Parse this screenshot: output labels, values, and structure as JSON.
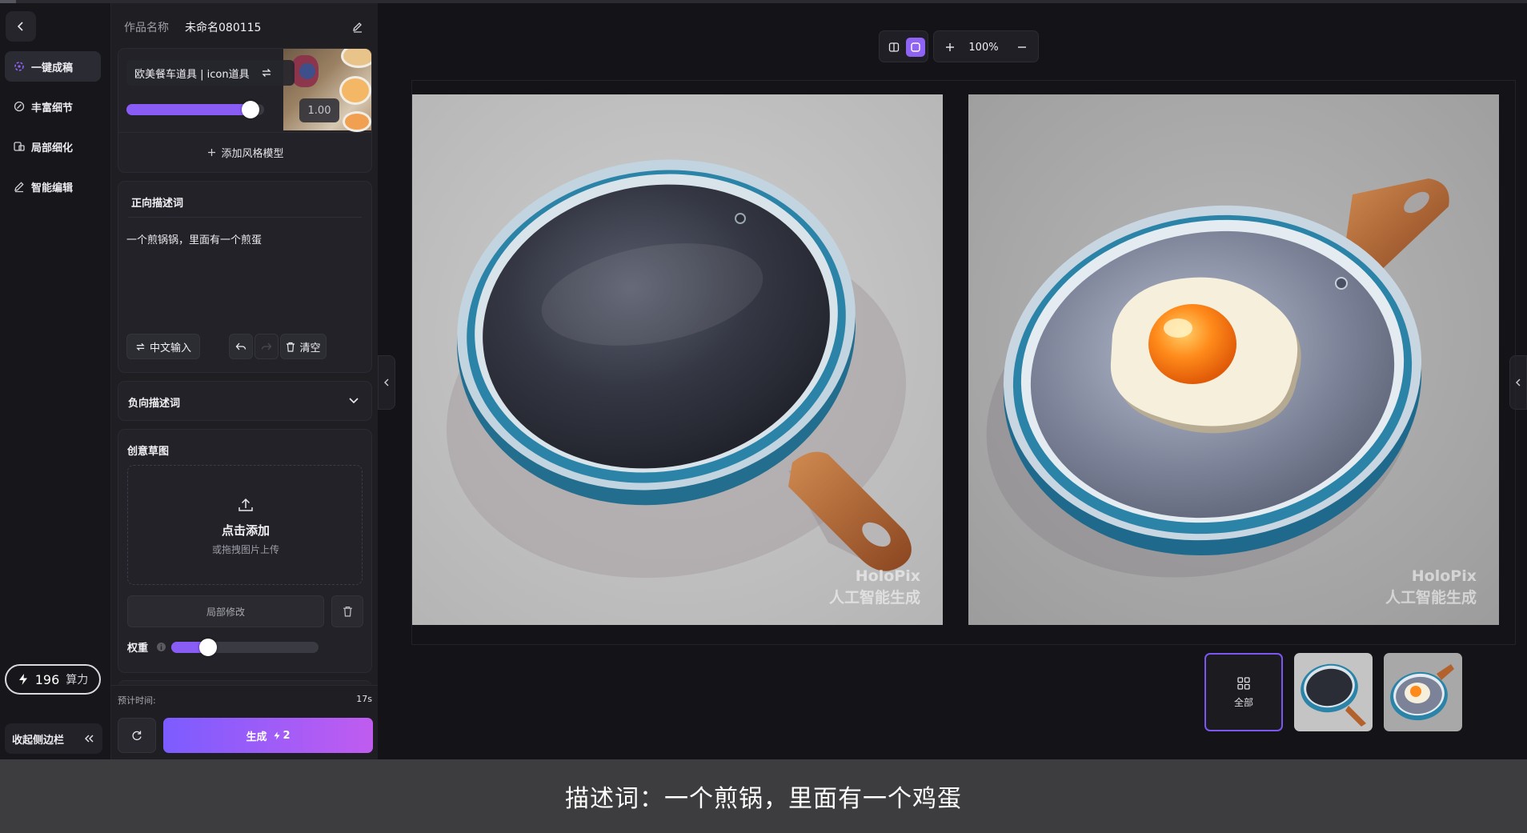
{
  "sidebar": {
    "items": [
      {
        "label": "一键成稿",
        "icon": "sparkle-icon",
        "active": true
      },
      {
        "label": "丰富细节",
        "icon": "detail-icon",
        "active": false
      },
      {
        "label": "局部细化",
        "icon": "partial-refine-icon",
        "active": false
      },
      {
        "label": "智能编辑",
        "icon": "pen-icon",
        "active": false
      }
    ],
    "credits_value": "196",
    "credits_unit": "算力",
    "collapse_label": "收起侧边栏"
  },
  "panel": {
    "work_name_label": "作品名称",
    "work_name_value": "未命名080115",
    "style_model": {
      "name": "欧美餐车道具 | icon道具",
      "weight_value": "1.00",
      "weight_fraction": 0.9,
      "add_label": "添加风格模型"
    },
    "prompt": {
      "title": "正向描述词",
      "text": "一个煎锅锅，里面有一个煎蛋",
      "cn_input_label": "中文输入",
      "clear_label": "清空"
    },
    "negative": {
      "title": "负向描述词"
    },
    "sketch": {
      "title": "创意草图",
      "upload_main": "点击添加",
      "upload_sub": "或拖拽图片上传",
      "local_edit_label": "局部修改",
      "weight_label": "权重",
      "weight_fraction": 0.25
    },
    "eta_label": "预计时间:",
    "eta_value": "17s",
    "generate_label": "生成",
    "generate_cost": "2"
  },
  "canvas": {
    "zoom_text": "100%",
    "watermark_line1": "HoloPix",
    "watermark_line2": "人工智能生成",
    "thumbs_all_label": "全部"
  },
  "caption": "描述词：一个煎锅，里面有一个鸡蛋",
  "colors": {
    "accent": "#8a5cf6",
    "generate_start": "#7c5cff",
    "generate_end": "#c05cf0",
    "pan_body": "#2b84a8",
    "handle": "#b4622d"
  }
}
